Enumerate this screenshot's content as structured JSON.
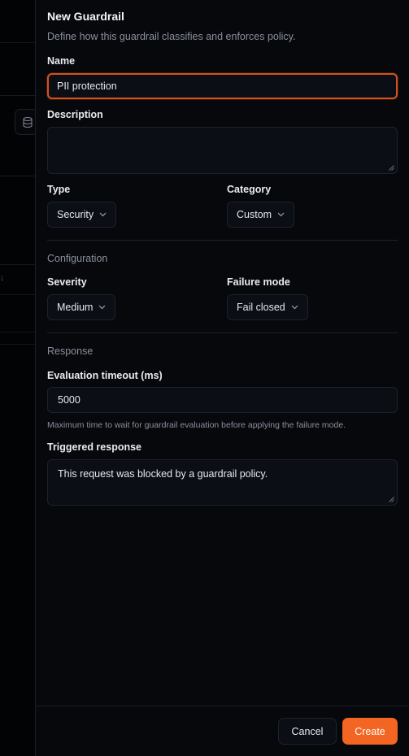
{
  "drawer": {
    "title": "New Guardrail",
    "subtitle": "Define how this guardrail classifies and enforces policy."
  },
  "form": {
    "name": {
      "label": "Name",
      "value": "PII protection"
    },
    "description": {
      "label": "Description",
      "value": ""
    },
    "type": {
      "label": "Type",
      "value": "Security"
    },
    "category": {
      "label": "Category",
      "value": "Custom"
    },
    "configuration_heading": "Configuration",
    "severity": {
      "label": "Severity",
      "value": "Medium"
    },
    "failure_mode": {
      "label": "Failure mode",
      "value": "Fail closed"
    },
    "response_heading": "Response",
    "timeout": {
      "label": "Evaluation timeout (ms)",
      "value": "5000",
      "helper": "Maximum time to wait for guardrail evaluation before applying the failure mode."
    },
    "triggered_response": {
      "label": "Triggered response",
      "value": "This request was blocked by a guardrail policy."
    }
  },
  "footer": {
    "cancel_label": "Cancel",
    "create_label": "Create"
  },
  "colors": {
    "accent": "#f26522",
    "focus_ring": "#d2531e",
    "panel": "#06080c"
  },
  "icons": {
    "select_chevron": "chevron-down-icon",
    "background_icon": "database-icon",
    "resize": "resize-handle-icon"
  }
}
